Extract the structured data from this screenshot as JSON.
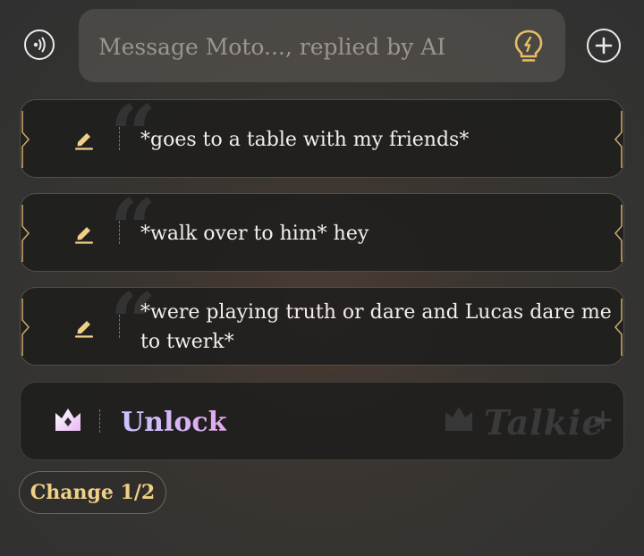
{
  "composer": {
    "placeholder": "Message Moto..., replied by AI",
    "voice_icon": "voice-wave-icon",
    "hint_icon": "lightbulb-icon",
    "add_icon": "plus-icon"
  },
  "suggestions": [
    {
      "text": "*goes to a table with my friends*",
      "icon": "pencil-icon"
    },
    {
      "text": "*walk over to him* hey",
      "icon": "pencil-icon"
    },
    {
      "text": "*were playing truth or dare and Lucas dare me to twerk*",
      "icon": "pencil-icon"
    }
  ],
  "unlock": {
    "label": "Unlock",
    "brand": "Talkie",
    "icon": "crown-icon"
  },
  "change_button": {
    "label": "Change 1/2"
  },
  "colors": {
    "accent_gold": "#f0cf86",
    "unlock_gradient_start": "#c9c3ff",
    "unlock_gradient_end": "#e2a9ee"
  }
}
